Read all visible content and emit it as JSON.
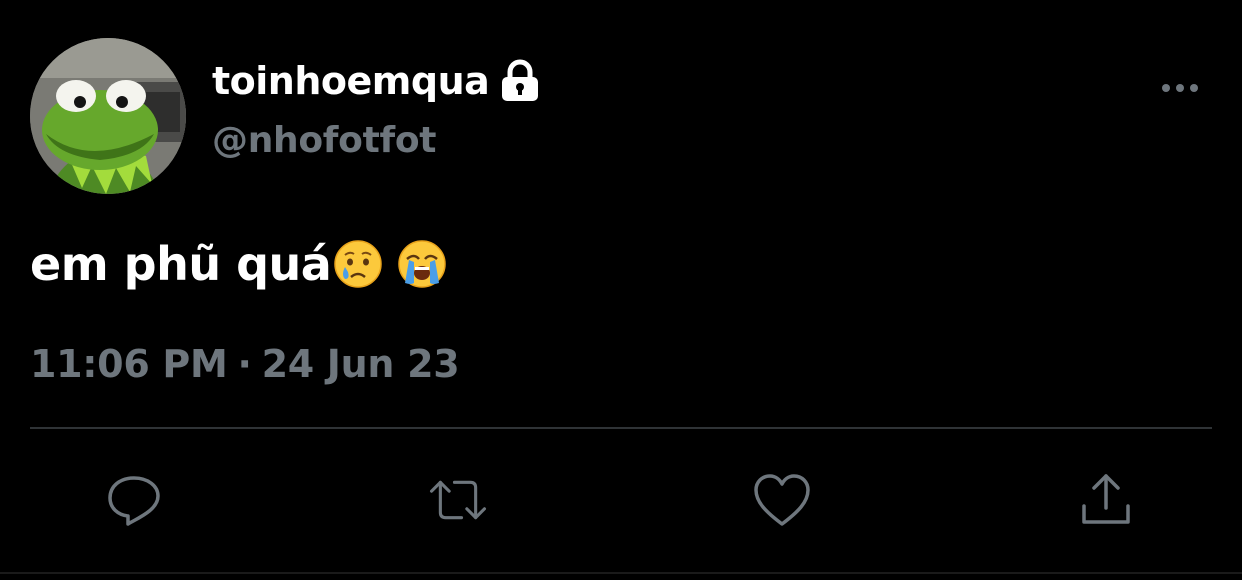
{
  "tweet": {
    "author": {
      "display_name": "toinhoemqua",
      "handle": "@nhofotfot",
      "protected_icon": "lock-icon",
      "avatar": "avatar"
    },
    "text": "em phũ quá",
    "emojis": [
      "crying-face-emoji",
      "loudly-crying-face-emoji"
    ],
    "time": "11:06 PM",
    "separator": "·",
    "date": "24 Jun 23",
    "menu_icon": "more-icon",
    "actions": [
      {
        "name": "reply",
        "icon": "reply-icon"
      },
      {
        "name": "retweet",
        "icon": "retweet-icon"
      },
      {
        "name": "like",
        "icon": "like-icon"
      },
      {
        "name": "share",
        "icon": "share-icon"
      }
    ]
  },
  "colors": {
    "background": "#000000",
    "primary_text": "#ffffff",
    "secondary_text": "#6e767d",
    "divider": "#2f3336",
    "icon": "#6e767d"
  }
}
